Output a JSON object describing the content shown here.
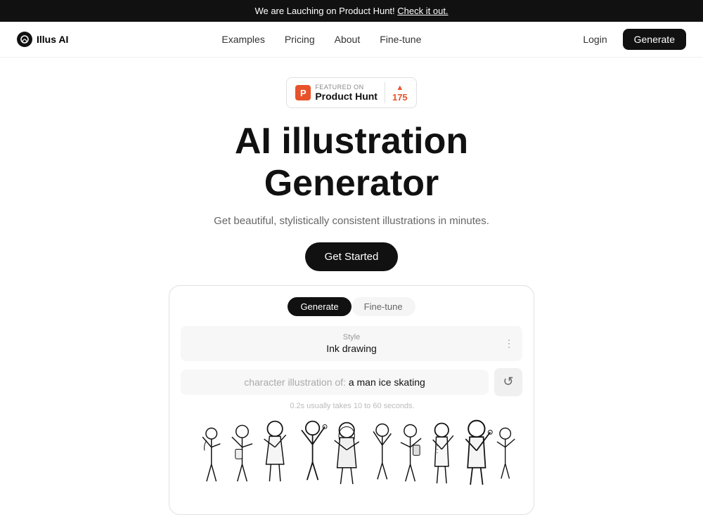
{
  "announcement": {
    "text": "We are Lauching on Product Hunt!",
    "link_text": "Check it out.",
    "link_url": "#"
  },
  "nav": {
    "logo": "Illus AI",
    "links": [
      "Examples",
      "Pricing",
      "About",
      "Fine-tune"
    ],
    "login": "Login",
    "generate": "Generate"
  },
  "product_hunt": {
    "featured_on": "FEATURED ON",
    "name": "Product Hunt",
    "votes_label": "▲",
    "votes_count": "175"
  },
  "hero": {
    "title_line1": "AI illustration",
    "title_line2": "Generator",
    "subtitle": "Get beautiful, stylistically consistent illustrations in minutes.",
    "cta": "Get Started"
  },
  "demo": {
    "tab_generate": "Generate",
    "tab_finetune": "Fine-tune",
    "style_label": "Style",
    "style_value": "Ink drawing",
    "prompt_prefix": "character illustration of:",
    "prompt_text": "a man ice skating",
    "timing": "0.2s usually takes 10 to 60 seconds."
  }
}
